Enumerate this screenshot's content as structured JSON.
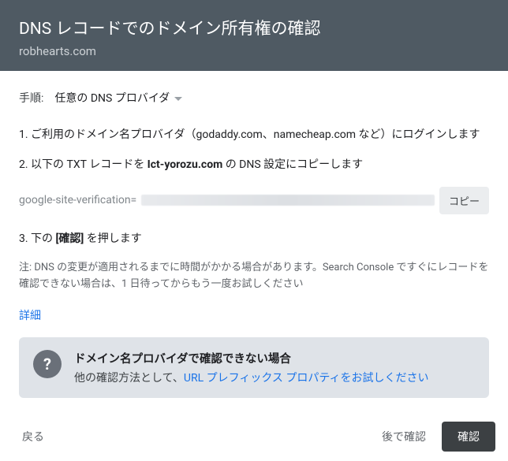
{
  "header": {
    "title": "DNS レコードでのドメイン所有権の確認",
    "domain": "robhearts.com"
  },
  "provider": {
    "label": "手順:",
    "selected": "任意の DNS プロバイダ"
  },
  "steps": {
    "s1": "1. ご利用のドメイン名プロバイダ（godaddy.com、namecheap.com など）にログインします",
    "s2_prefix": "2. 以下の TXT レコードを ",
    "s2_bold": "Ict-yorozu.com",
    "s2_suffix": " の DNS 設定にコピーします",
    "s3_prefix": "3. 下の ",
    "s3_bold": "[確認]",
    "s3_suffix": " を押します"
  },
  "token": {
    "prefix": "google-site-verification=",
    "copy": "コピー"
  },
  "note": "注: DNS の変更が適用されるまでに時間がかかる場合があります。Search Console ですぐにレコードを確認できない場合は、1 日待ってからもう一度お試しください",
  "details_link": "詳細",
  "alt": {
    "title": "ドメイン名プロバイダで確認できない場合",
    "body_prefix": "他の確認方法として、",
    "link": "URL プレフィックス プロパティをお試しください"
  },
  "footer": {
    "back": "戻る",
    "later": "後で確認",
    "confirm": "確認"
  }
}
